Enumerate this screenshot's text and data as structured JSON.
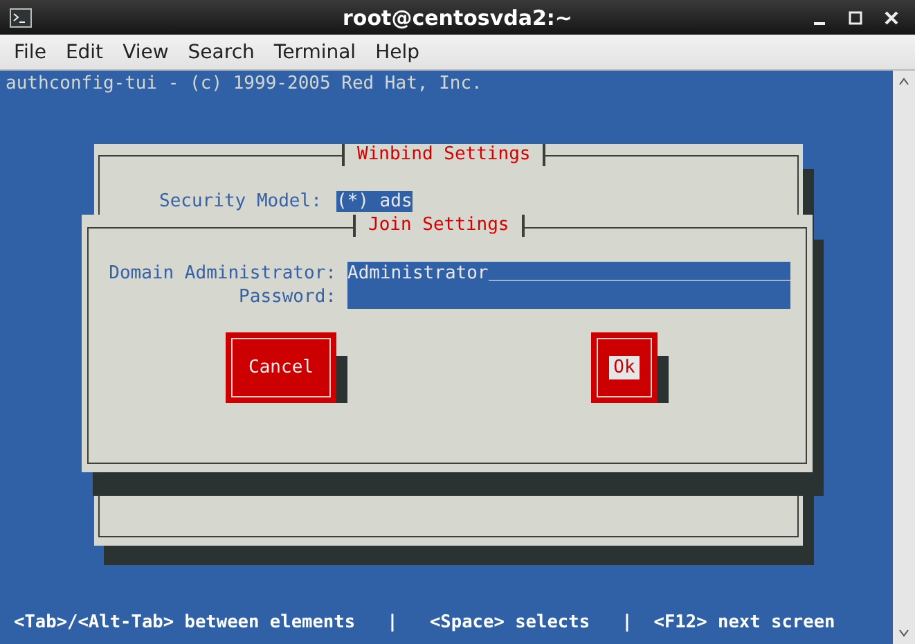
{
  "window": {
    "title": "root@centosvda2:~"
  },
  "menu": [
    "File",
    "Edit",
    "View",
    "Search",
    "Terminal",
    "Help"
  ],
  "terminal": {
    "header": "authconfig-tui - (c) 1999-2005 Red Hat, Inc.",
    "status_line": "<Tab>/<Alt-Tab> between elements   |   <Space> selects   |  <F12> next screen"
  },
  "winbind_dialog": {
    "title": "Winbind Settings",
    "security_model": {
      "label": "Security Model:",
      "value": "(*) ads"
    }
  },
  "join_dialog": {
    "title": "Join Settings",
    "fields": [
      {
        "label": "Domain Administrator:",
        "value": "Administrator"
      },
      {
        "label": "Password:"
      }
    ],
    "buttons": [
      {
        "label": "Cancel",
        "selected": false
      },
      {
        "label": "Ok",
        "selected": true
      }
    ]
  }
}
